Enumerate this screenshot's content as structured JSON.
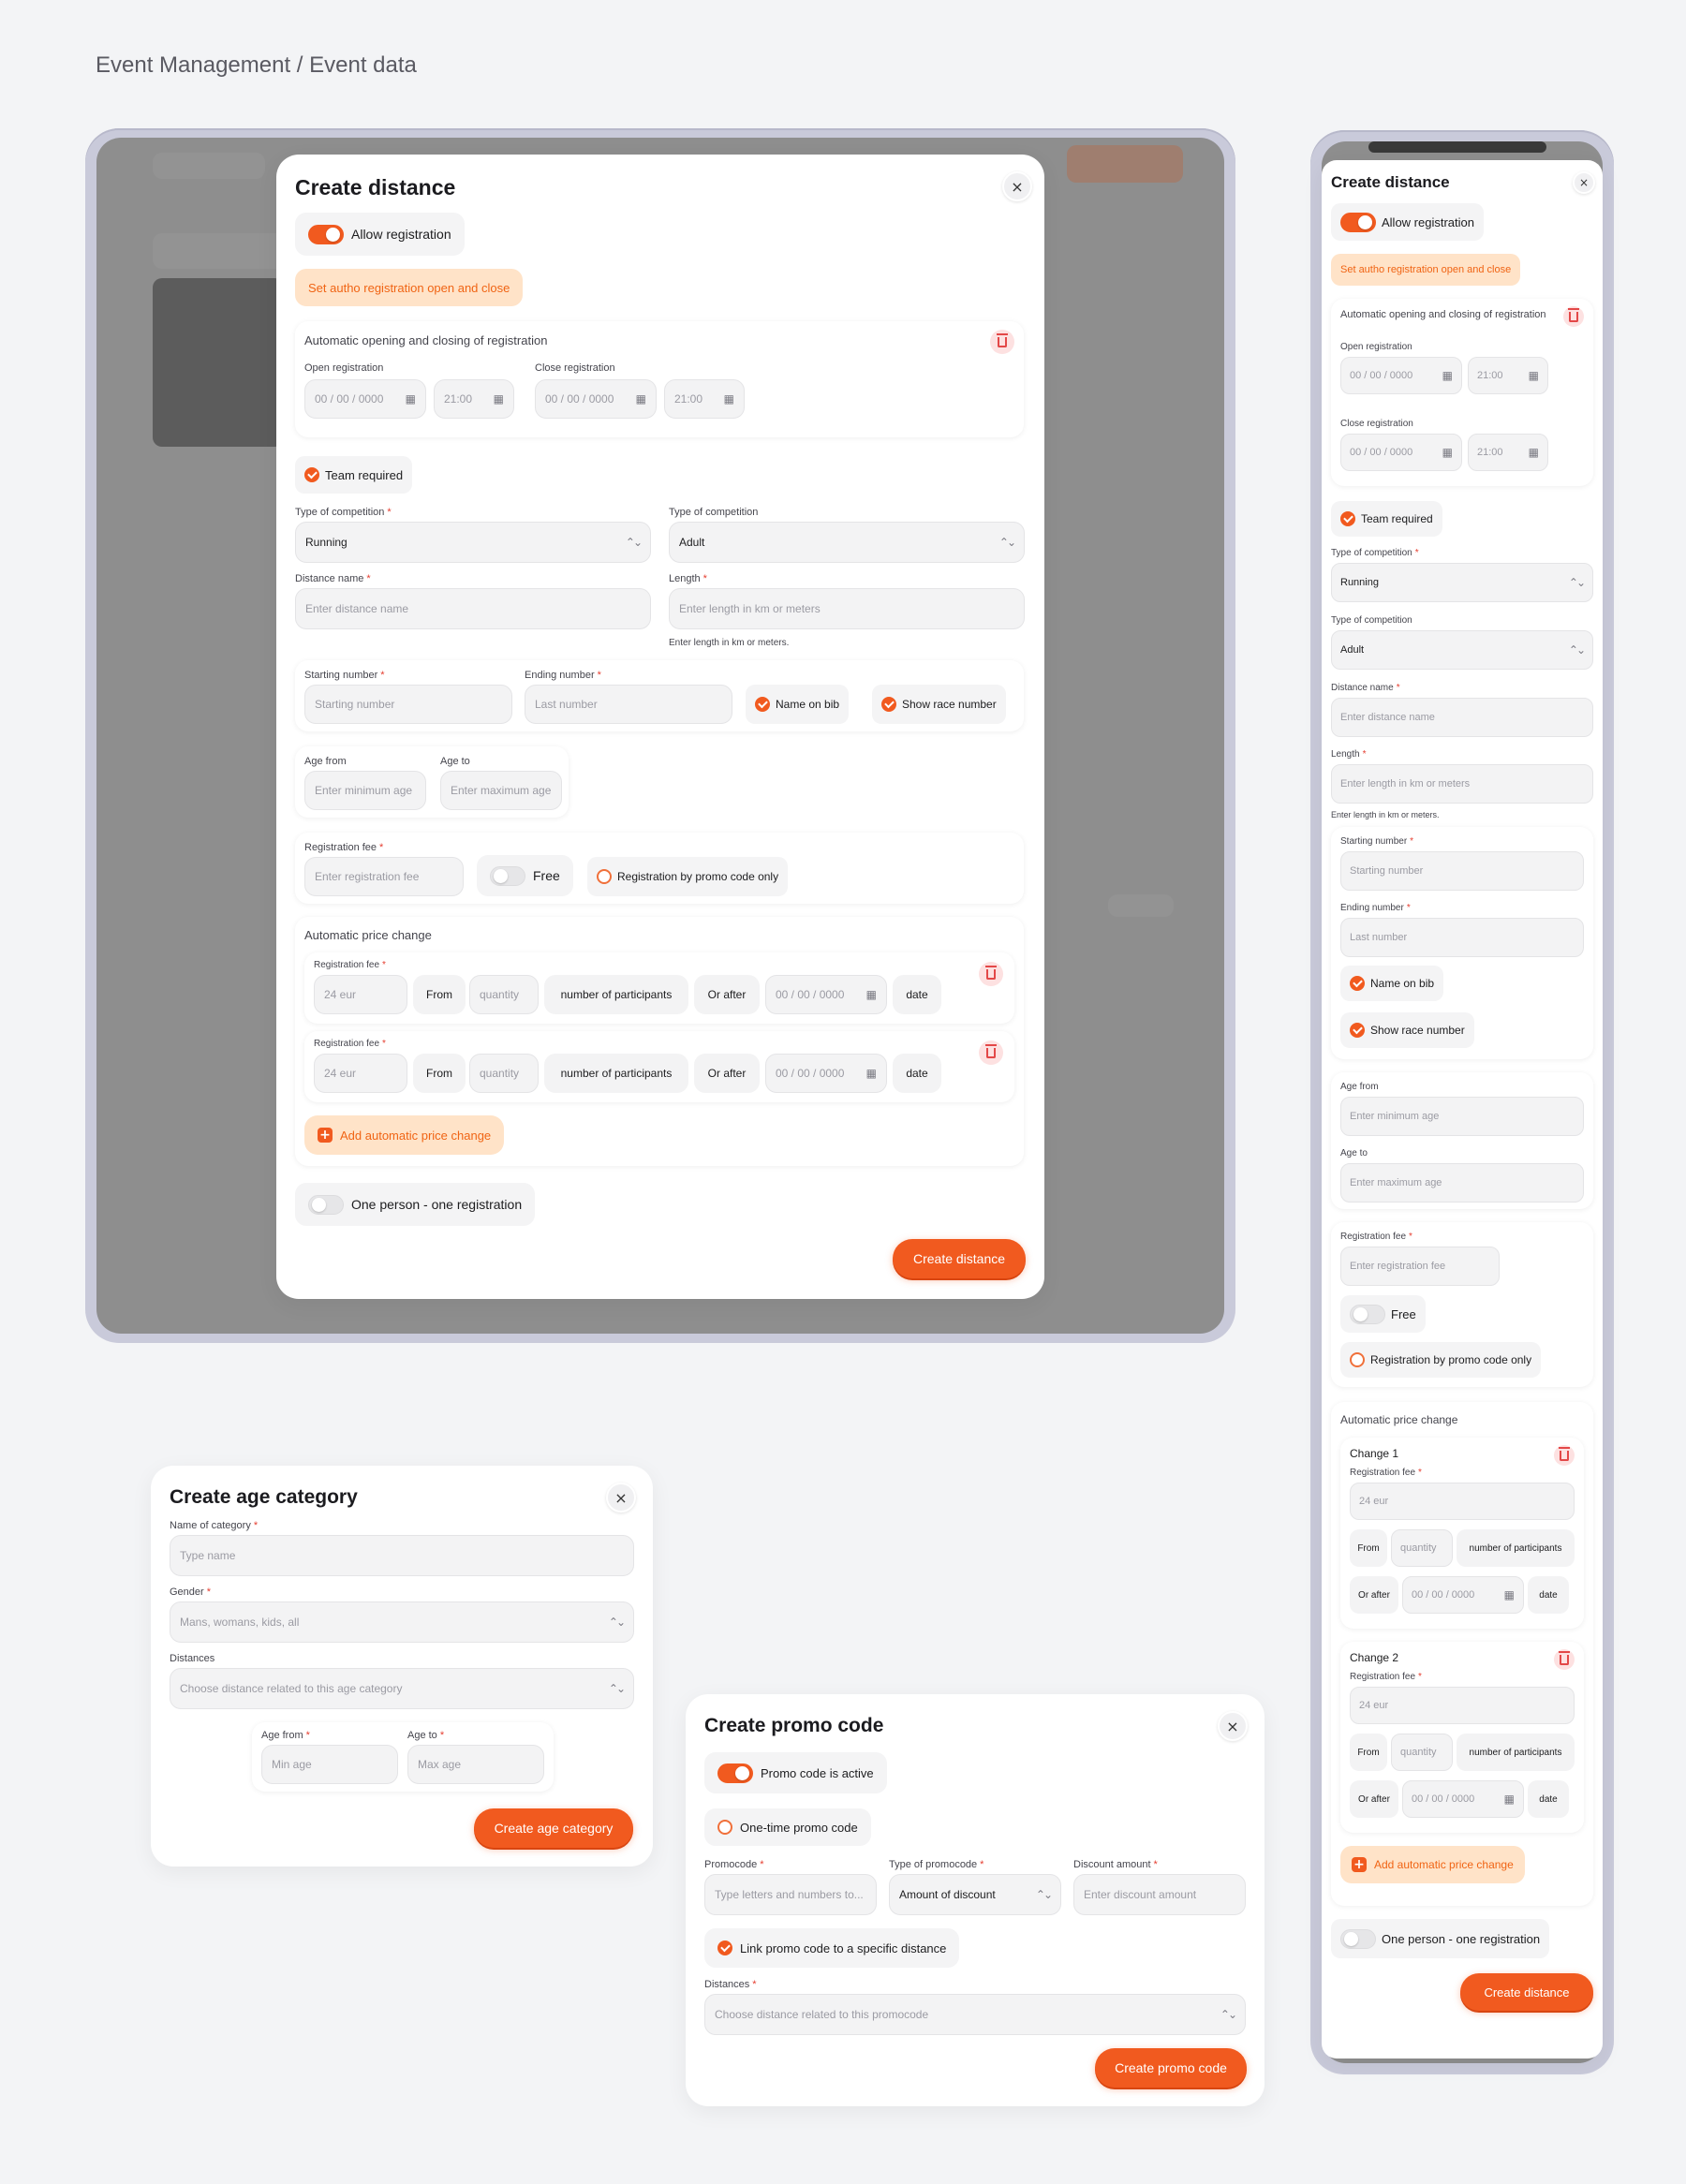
{
  "breadcrumb": "Event Management / Event data",
  "distance": {
    "title": "Create distance",
    "close": "×",
    "allow_registration": "Allow registration",
    "set_autho": "Set autho registration open and close",
    "auto_title": "Automatic opening and closing of registration",
    "open_registration": "Open registration",
    "close_registration": "Close registration",
    "date_ph": "00 / 00 / 0000",
    "time_ph": "21:00",
    "team_required": "Team required",
    "type_comp_label": "Type of competition",
    "type_comp_value_1": "Running",
    "type_comp_value_2": "Adult",
    "distance_name_label": "Distance name",
    "distance_name_ph": "Enter distance name",
    "length_label": "Length",
    "length_ph": "Enter length in km or meters",
    "length_hint": "Enter length in km or meters.",
    "starting_number_label": "Starting number",
    "starting_number_ph": "Starting number",
    "ending_number_label": "Ending number",
    "ending_number_ph": "Last number",
    "name_on_bib": "Name on bib",
    "show_race_number": "Show race number",
    "age_from_label": "Age from",
    "age_from_ph": "Enter minimum age",
    "age_to_label": "Age to",
    "age_to_ph": "Enter maximum age",
    "reg_fee_label": "Registration fee",
    "reg_fee_ph": "Enter registration fee",
    "free": "Free",
    "promo_only": "Registration by promo code only",
    "auto_price_title": "Automatic price change",
    "change1": "Change 1",
    "change2": "Change 2",
    "fee_value": "24 eur",
    "from": "From",
    "quantity_ph": "quantity",
    "number_of_participants": "number of participants",
    "or_after": "Or after",
    "date": "date",
    "add_auto_price": "Add automatic price change",
    "one_person": "One person - one registration",
    "submit": "Create distance"
  },
  "age_category": {
    "title": "Create age category",
    "close": "×",
    "name_label": "Name of category",
    "name_ph": "Type name",
    "gender_label": "Gender",
    "gender_ph": "Mans, womans, kids, all",
    "distances_label": "Distances",
    "distances_ph": "Choose distance related to this age category",
    "age_from_label": "Age from",
    "age_from_ph": "Min age",
    "age_to_label": "Age to",
    "age_to_ph": "Max age",
    "submit": "Create age category"
  },
  "promo": {
    "title": "Create promo code",
    "close": "×",
    "active": "Promo code is active",
    "one_time": "One-time promo code",
    "promocode_label": "Promocode",
    "promocode_ph": "Type letters and numbers to...",
    "type_label": "Type of promocode",
    "type_value": "Amount of discount",
    "discount_label": "Discount amount",
    "discount_ph": "Enter discount amount",
    "link": "Link promo code to a specific distance",
    "distances_label": "Distances",
    "distances_ph": "Choose distance related to this promocode",
    "submit": "Create promo code"
  },
  "colors": {
    "accent": "#f15a1f",
    "accent_soft": "#ffe3c8",
    "danger": "#e34848",
    "frame": "#c9cada",
    "overlay": "#8e8e8e"
  }
}
